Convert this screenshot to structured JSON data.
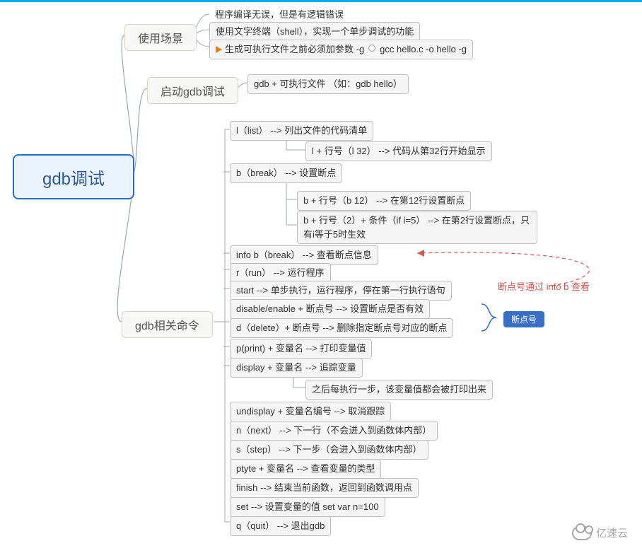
{
  "root": "gdb调试",
  "branch1": {
    "label": "使用场景",
    "items": [
      "程序编译无误，但是有逻辑错误",
      "使用文字终端（shell），实现一个单步调试的功能"
    ],
    "flag_item_left": "生成可执行文件之前必须加参数 -g",
    "flag_item_right": "gcc hello.c -o hello -g"
  },
  "branch2": {
    "label": "启动gdb调试",
    "item": "gdb + 可执行文件 （如：gdb hello）"
  },
  "branch3": {
    "label": "gdb相关命令",
    "items": {
      "l_list": "l（list） --> 列出文件的代码清单",
      "l_line_sub": "l + 行号（l 32） --> 代码从第32行开始显示",
      "b_break": "b（break） --> 设置断点",
      "b_line_sub": "b + 行号（b 12） --> 在第12行设置断点",
      "b_cond_sub": "b + 行号（2）+ 条件（if i=5） --> 在第2行设置断点，只有i等于5时生效",
      "info_b": "info b（break） --> 查看断点信息",
      "r_run": "r（run） --> 运行程序",
      "start": "start --> 单步执行，运行程序，停在第一行执行语句",
      "disable_enable": "disable/enable + 断点号 --> 设置断点是否有效",
      "d_delete": "d（delete）+ 断点号 --> 删除指定断点号对应的断点",
      "p_print": "p(print) + 变量名 --> 打印变量值",
      "display": "display + 变量名 --> 追踪变量",
      "display_sub": "之后每执行一步，该变量值都会被打印出来",
      "undisplay": "undisplay + 变量名编号 --> 取消跟踪",
      "n_next": "n（next） --> 下一行（不会进入到函数体内部）",
      "s_step": "s（step） --> 下一步（会进入到函数体内部）",
      "ptype": "ptyte + 变量名 --> 查看变量的类型",
      "finish": "finish --> 结束当前函数，返回到函数调用点",
      "set": "set --> 设置变量的值  set var n=100",
      "q_quit": "q（quit） --> 退出gdb"
    }
  },
  "annotation": {
    "text": "断点号通过 info b 查看",
    "tag": "断点号"
  },
  "watermark": "亿速云"
}
